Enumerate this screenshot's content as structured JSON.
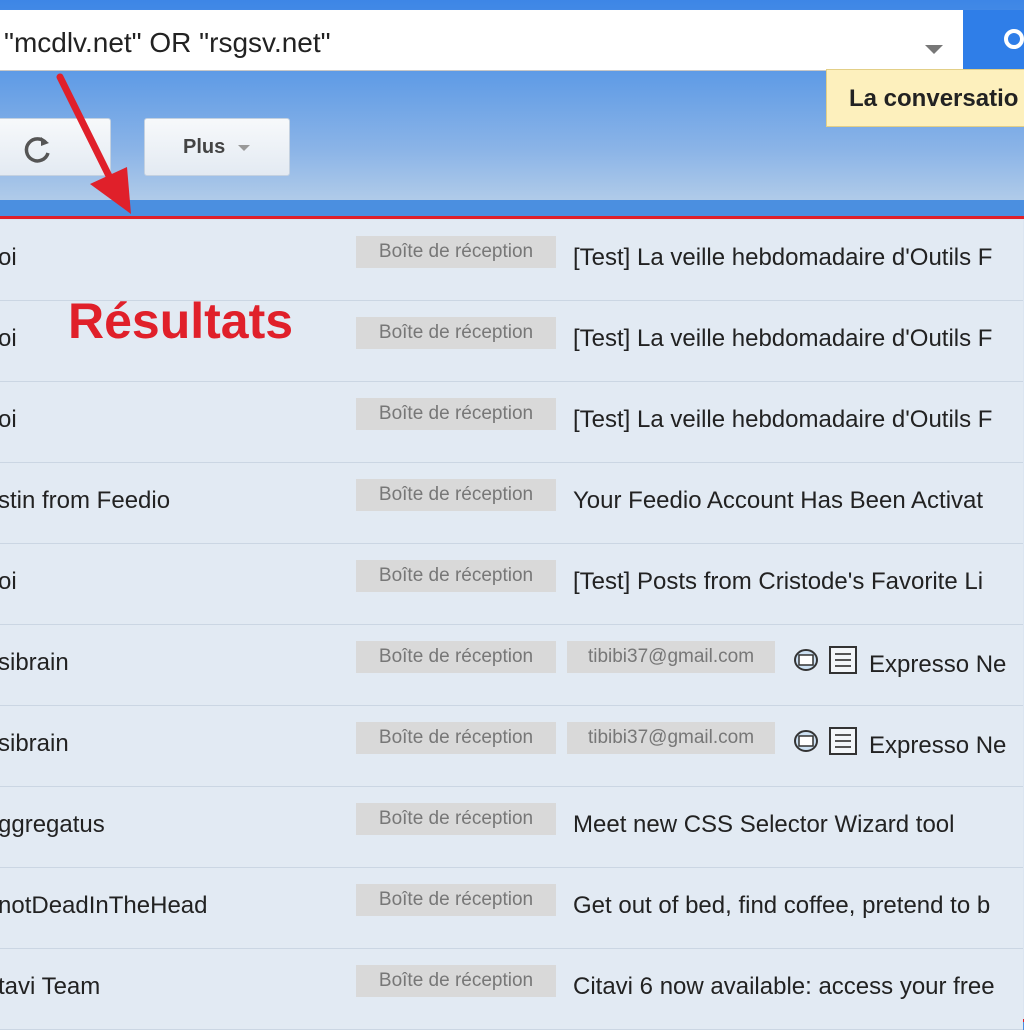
{
  "search": {
    "query": "\"mcdlv.net\" OR \"rsgsv.net\""
  },
  "tooltip": {
    "text": "La conversatio"
  },
  "toolbar": {
    "more_label": "Plus"
  },
  "annotation": {
    "label": "Résultats",
    "color": "#e0202a"
  },
  "colors": {
    "accent": "#2f7ee8",
    "highlight": "#e0202a",
    "row_bg": "#e2eaf3",
    "chip_bg": "#d9d9d9"
  },
  "rows": [
    {
      "sender": "oi",
      "label": "Boîte de réception",
      "subject": "[Test] La veille hebdomadaire d'Outils F"
    },
    {
      "sender": "oi",
      "label": "Boîte de réception",
      "subject": "[Test] La veille hebdomadaire d'Outils F"
    },
    {
      "sender": "oi",
      "label": "Boîte de réception",
      "subject": "[Test] La veille hebdomadaire d'Outils F"
    },
    {
      "sender": "stin from Feedio",
      "label": "Boîte de réception",
      "subject": "Your Feedio Account Has Been Activat"
    },
    {
      "sender": "oi",
      "label": "Boîte de réception",
      "subject": "[Test] Posts from Cristode's Favorite Li"
    },
    {
      "sender": "sibrain",
      "label": "Boîte de réception",
      "email": "tibibi37@gmail.com",
      "subject": "Expresso Ne"
    },
    {
      "sender": "sibrain",
      "label": "Boîte de réception",
      "email": "tibibi37@gmail.com",
      "subject": "Expresso Ne"
    },
    {
      "sender": "ggregatus",
      "label": "Boîte de réception",
      "subject": "Meet new CSS Selector Wizard tool"
    },
    {
      "sender": "notDeadInTheHead",
      "label": "Boîte de réception",
      "subject": "Get out of bed, find coffee, pretend to b"
    },
    {
      "sender": "tavi Team",
      "label": "Boîte de réception",
      "subject": "Citavi 6 now available: access your free"
    }
  ]
}
